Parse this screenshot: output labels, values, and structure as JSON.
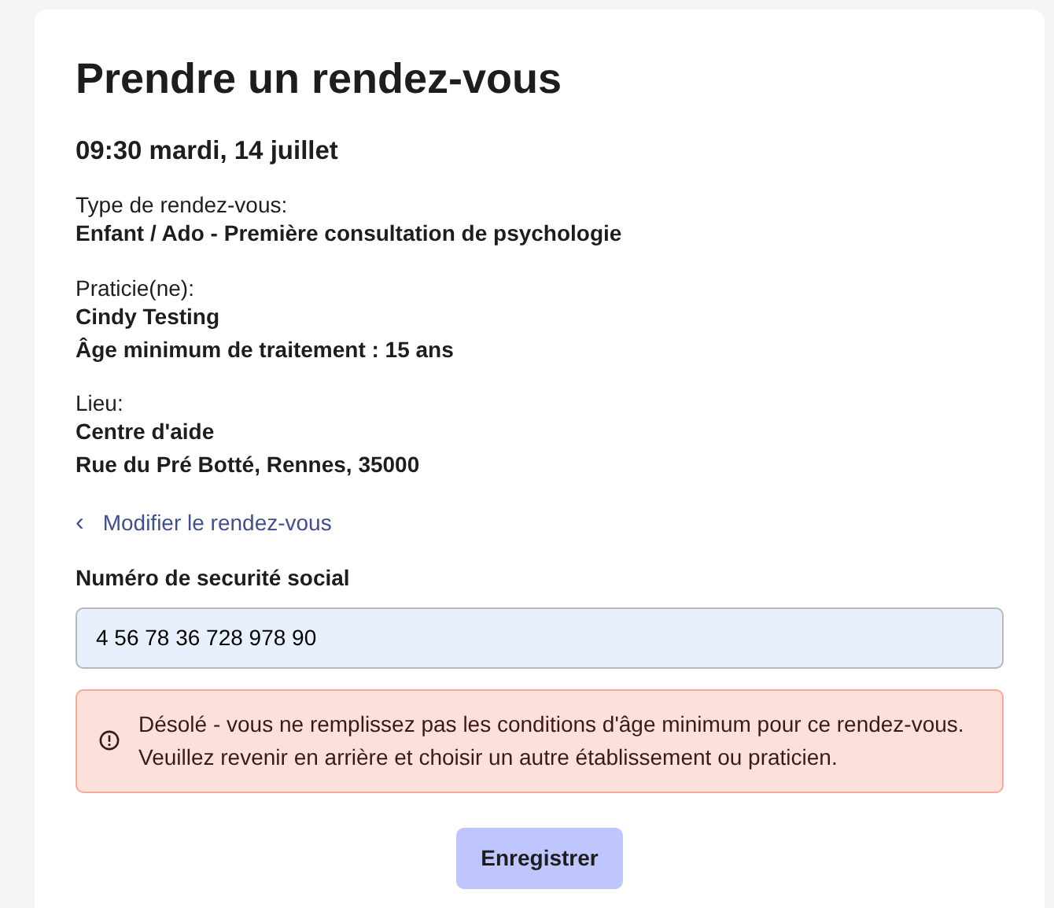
{
  "title": "Prendre un rendez-vous",
  "datetime": "09:30 mardi, 14 juillet",
  "sections": [
    {
      "label": "Type de rendez-vous:",
      "values": [
        "Enfant / Ado - Première consultation de psychologie"
      ]
    },
    {
      "label": "Praticie(ne):",
      "values": [
        "Cindy Testing",
        "Âge minimum de traitement : 15 ans"
      ]
    },
    {
      "label": "Lieu:",
      "values": [
        "Centre d'aide",
        "Rue du Pré Botté, Rennes, 35000"
      ]
    }
  ],
  "back_link": {
    "icon": "‹",
    "label": "Modifier le rendez-vous"
  },
  "ssn_field": {
    "label": "Numéro de securité social",
    "value": "4 56 78 36 728 978 90"
  },
  "alert": {
    "kind": "error",
    "lines": [
      "Désolé - vous ne remplissez pas les conditions d'âge minimum pour ce rendez-vous.",
      "Veuillez revenir en arrière et choisir un autre établissement ou praticien."
    ]
  },
  "submit_button": {
    "label": "Enregistrer"
  }
}
